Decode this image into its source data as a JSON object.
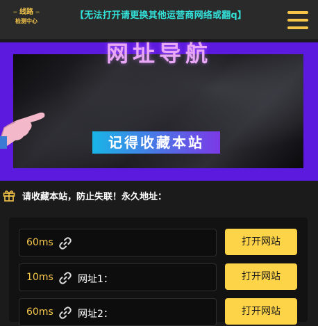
{
  "header": {
    "logo_top": "线路",
    "logo_bottom": "检测中心",
    "notice": "【无法打开请更换其他运营商网络或翻q】",
    "menu_icon": "hamburger-menu-icon"
  },
  "banner": {
    "title": "网址导航",
    "subtitle": "记得收藏本站"
  },
  "bookmark_notice": {
    "icon": "gift-icon",
    "text": "请收藏本站，防止失联！永久地址："
  },
  "links": [
    {
      "latency": "60ms",
      "label": "",
      "button": "打开网站"
    },
    {
      "latency": "10ms",
      "label": "网址1：",
      "button": "打开网站"
    },
    {
      "latency": "60ms",
      "label": "网址2：",
      "button": "打开网站"
    }
  ],
  "colors": {
    "accent": "#fdd347",
    "notice_text": "#33e0d8",
    "banner_bg": "#5d1adf"
  }
}
